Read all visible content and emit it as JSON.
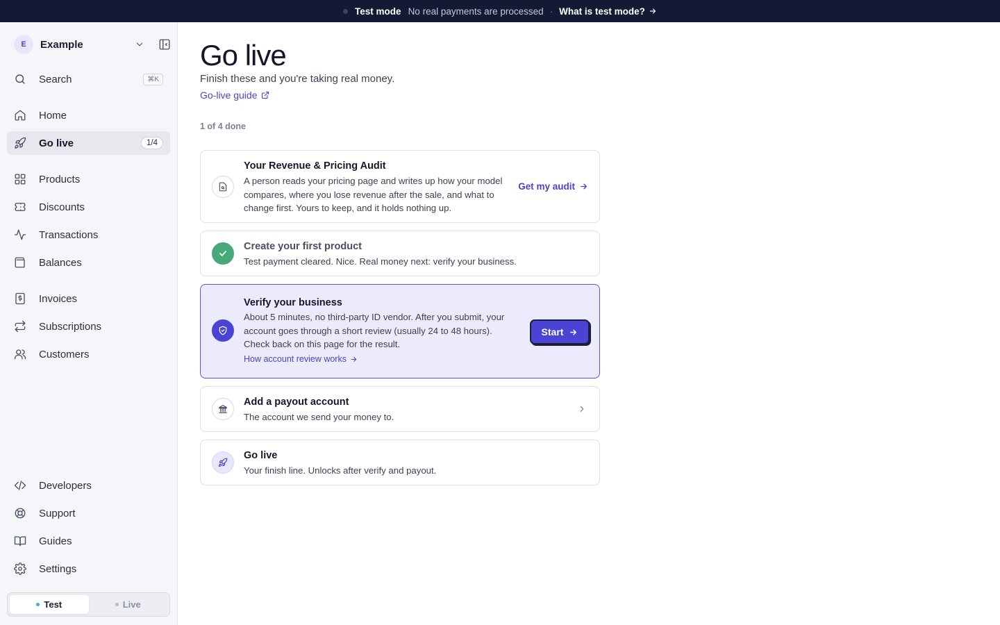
{
  "banner": {
    "mode_label": "Test mode",
    "mode_text": "No real payments are processed",
    "separator": "·",
    "link_label": "What is test mode?"
  },
  "workspace": {
    "avatar_letter": "E",
    "name": "Example"
  },
  "sidebar": {
    "search": {
      "label": "Search",
      "shortcut": "⌘K"
    },
    "items": [
      {
        "label": "Home",
        "icon": "home-icon"
      },
      {
        "label": "Go live",
        "icon": "rocket-icon",
        "badge": "1/4",
        "active": true
      },
      {
        "label": "Products",
        "icon": "grid-icon"
      },
      {
        "label": "Discounts",
        "icon": "ticket-icon"
      },
      {
        "label": "Transactions",
        "icon": "activity-icon"
      },
      {
        "label": "Balances",
        "icon": "wallet-icon"
      },
      {
        "label": "Invoices",
        "icon": "invoice-icon"
      },
      {
        "label": "Subscriptions",
        "icon": "repeat-icon"
      },
      {
        "label": "Customers",
        "icon": "users-icon"
      }
    ],
    "footer_items": [
      {
        "label": "Developers",
        "icon": "code-icon"
      },
      {
        "label": "Support",
        "icon": "lifebuoy-icon"
      },
      {
        "label": "Guides",
        "icon": "book-icon"
      },
      {
        "label": "Settings",
        "icon": "gear-icon"
      }
    ],
    "env_toggle": {
      "options": [
        "Test",
        "Live"
      ],
      "selected": "Test",
      "test_color": "#35b6d6",
      "live_color": "#b8bcc8"
    }
  },
  "page": {
    "title": "Go live",
    "subtitle": "Finish these and you're taking real money.",
    "guide_link": "Go-live guide",
    "progress": "1 of 4 done"
  },
  "tasks": [
    {
      "title": "Your Revenue & Pricing Audit",
      "description": "A person reads your pricing page and writes up how your model compares, where you lose revenue after the sale, and what to change first. Yours to keep, and it holds nothing up.",
      "action": "Get my audit",
      "icon": "document-search-icon",
      "status": "todo"
    },
    {
      "title": "Create your first product",
      "description": "Test payment cleared. Nice. Real money next: verify your business.",
      "icon": "check-icon",
      "status": "done"
    },
    {
      "title": "Verify your business",
      "description": "About 5 minutes, no third-party ID vendor. After you submit, your account goes through a short review (usually 24 to 48 hours). Check back on this page for the result.",
      "link": "How account review works",
      "action": "Start",
      "icon": "shield-check-icon",
      "status": "active"
    },
    {
      "title": "Add a payout account",
      "description": "The account we send your money to.",
      "icon": "bank-icon",
      "status": "todo"
    },
    {
      "title": "Go live",
      "description": "Your finish line. Unlocks after verify and payout.",
      "icon": "rocket-icon",
      "status": "locked"
    }
  ],
  "colors": {
    "accent": "#4a43d4",
    "success": "#45a979",
    "banner_bg": "#141a33",
    "active_card_bg": "#ecebfb"
  }
}
